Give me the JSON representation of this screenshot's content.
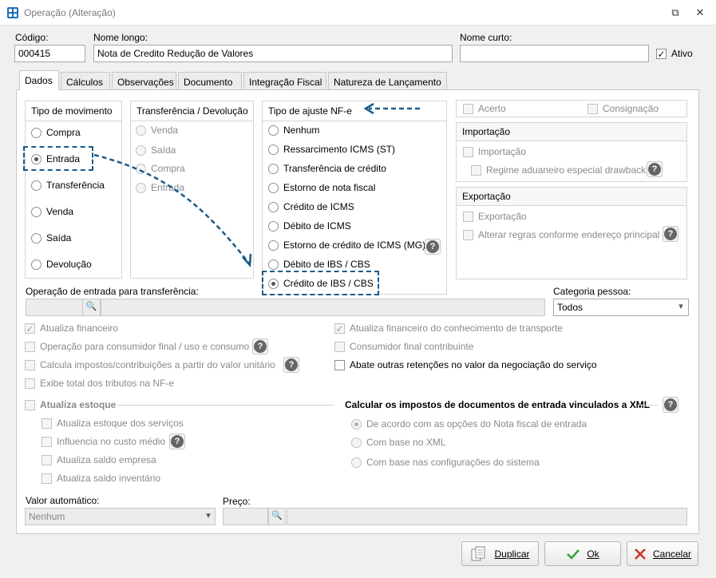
{
  "window": {
    "title": "Operação (Alteração)",
    "restore_glyph": "⧉",
    "close_glyph": "✕"
  },
  "header": {
    "codigo_label": "Código:",
    "codigo_value": "000415",
    "nome_longo_label": "Nome longo:",
    "nome_longo_value": "Nota de Credito Redução de Valores",
    "nome_curto_label": "Nome curto:",
    "nome_curto_value": "",
    "ativo_label": "Ativo",
    "ativo_checked": true
  },
  "tabs": [
    "Dados",
    "Cálculos",
    "Observações",
    "Documento",
    "Integração Fiscal",
    "Natureza de Lançamento"
  ],
  "tipo_movimento": {
    "title": "Tipo de movimento",
    "options": [
      "Compra",
      "Entrada",
      "Transferência",
      "Venda",
      "Saída",
      "Devolução"
    ],
    "selected": "Entrada"
  },
  "transferencia": {
    "title": "Transferência / Devolução",
    "options": [
      "Venda",
      "Saída",
      "Compra",
      "Entrada"
    ]
  },
  "tipo_ajuste": {
    "title": "Tipo de ajuste NF-e",
    "options": [
      "Nenhum",
      "Ressarcimento ICMS (ST)",
      "Transferência de crédito",
      "Estorno de nota fiscal",
      "Crédito de ICMS",
      "Débito de ICMS",
      "Estorno de crédito de ICMS (MG)",
      "Débito de IBS / CBS",
      "Crédito de IBS / CBS"
    ],
    "selected": "Crédito de IBS / CBS"
  },
  "right_panel": {
    "acerto": "Acerto",
    "consignacao": "Consignação",
    "importacao_title": "Importação",
    "importacao": "Importação",
    "regime": "Regime aduaneiro especial drawback",
    "exportacao_title": "Exportação",
    "exportacao": "Exportação",
    "alterar_regras": "Alterar regras conforme endereço principal"
  },
  "operacao_entrada": {
    "label": "Operação de entrada para transferência:",
    "search_glyph": "🔍"
  },
  "categoria": {
    "label": "Categoria pessoa:",
    "value": "Todos",
    "arrow": "▾"
  },
  "checks_left": [
    {
      "label": "Atualiza financeiro",
      "checked": true
    },
    {
      "label": "Operação para consumidor final / uso e consumo",
      "checked": false
    },
    {
      "label": "Calcula impostos/contribuições a partir do valor unitário",
      "checked": false
    },
    {
      "label": "Exibe total dos tributos na NF-e",
      "checked": false
    }
  ],
  "checks_right": [
    {
      "label": "Atualiza financeiro do conhecimento de transporte",
      "checked": true
    },
    {
      "label": "Consumidor final contribuinte",
      "checked": false
    },
    {
      "label": "Abate outras retenções no valor da negociação do serviço",
      "checked": false
    }
  ],
  "estoque": {
    "title": "Atualiza estoque",
    "items": [
      "Atualiza estoque dos serviços",
      "Influencia no custo médio",
      "Atualiza saldo empresa",
      "Atualiza saldo inventário"
    ]
  },
  "calcular_xml": {
    "title": "Calcular os impostos de documentos de entrada vinculados a XML",
    "options": [
      "De acordo com as opções do Nota fiscal de entrada",
      "Com base no XML",
      "Com base nas configurações do sistema"
    ]
  },
  "valor_automatico": {
    "label": "Valor automático:",
    "value": "Nenhum",
    "arrow": "▾"
  },
  "preco": {
    "label": "Preço:"
  },
  "help_glyph": "?",
  "buttons": {
    "duplicar": "Duplicar",
    "ok": "Ok",
    "cancelar": "Cancelar"
  },
  "colors": {
    "annotation": "#1a5b8a",
    "ok_icon": "#3aa03a",
    "cancel_icon": "#d0352b"
  }
}
